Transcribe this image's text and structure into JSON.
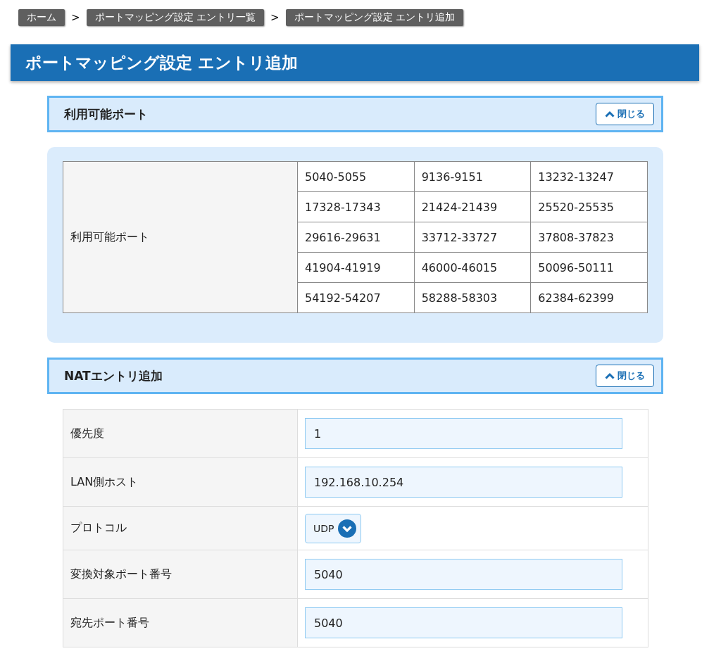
{
  "breadcrumbs": [
    {
      "kind": "link",
      "label": "ホーム"
    },
    {
      "kind": "separator",
      "label": ">"
    },
    {
      "kind": "link",
      "label": "ポートマッピング設定 エントリ一覧"
    },
    {
      "kind": "separator",
      "label": ">"
    },
    {
      "kind": "link",
      "label": "ポートマッピング設定 エントリ追加"
    }
  ],
  "page_title": "ポートマッピング設定 エントリ追加",
  "ports_section": {
    "title": "利用可能ポート",
    "close_button": "閉じる",
    "table": {
      "label": "利用可能ポート",
      "rows": [
        [
          "5040-5055",
          "9136-9151",
          "13232-13247"
        ],
        [
          "17328-17343",
          "21424-21439",
          "25520-25535"
        ],
        [
          "29616-29631",
          "33712-33727",
          "37808-37823"
        ],
        [
          "41904-41919",
          "46000-46015",
          "50096-50111"
        ],
        [
          "54192-54207",
          "58288-58303",
          "62384-62399"
        ]
      ]
    }
  },
  "nat_section": {
    "title": "NATエントリ追加",
    "close_button": "閉じる",
    "fields": [
      {
        "kind": "input",
        "label": "優先度",
        "value": "1"
      },
      {
        "kind": "input",
        "label": "LAN側ホスト",
        "value": "192.168.10.254"
      },
      {
        "kind": "select",
        "label": "プロトコル",
        "value": "UDP"
      },
      {
        "kind": "input",
        "label": "変換対象ポート番号",
        "value": "5040"
      },
      {
        "kind": "input",
        "label": "宛先ポート番号",
        "value": "5040"
      }
    ]
  }
}
